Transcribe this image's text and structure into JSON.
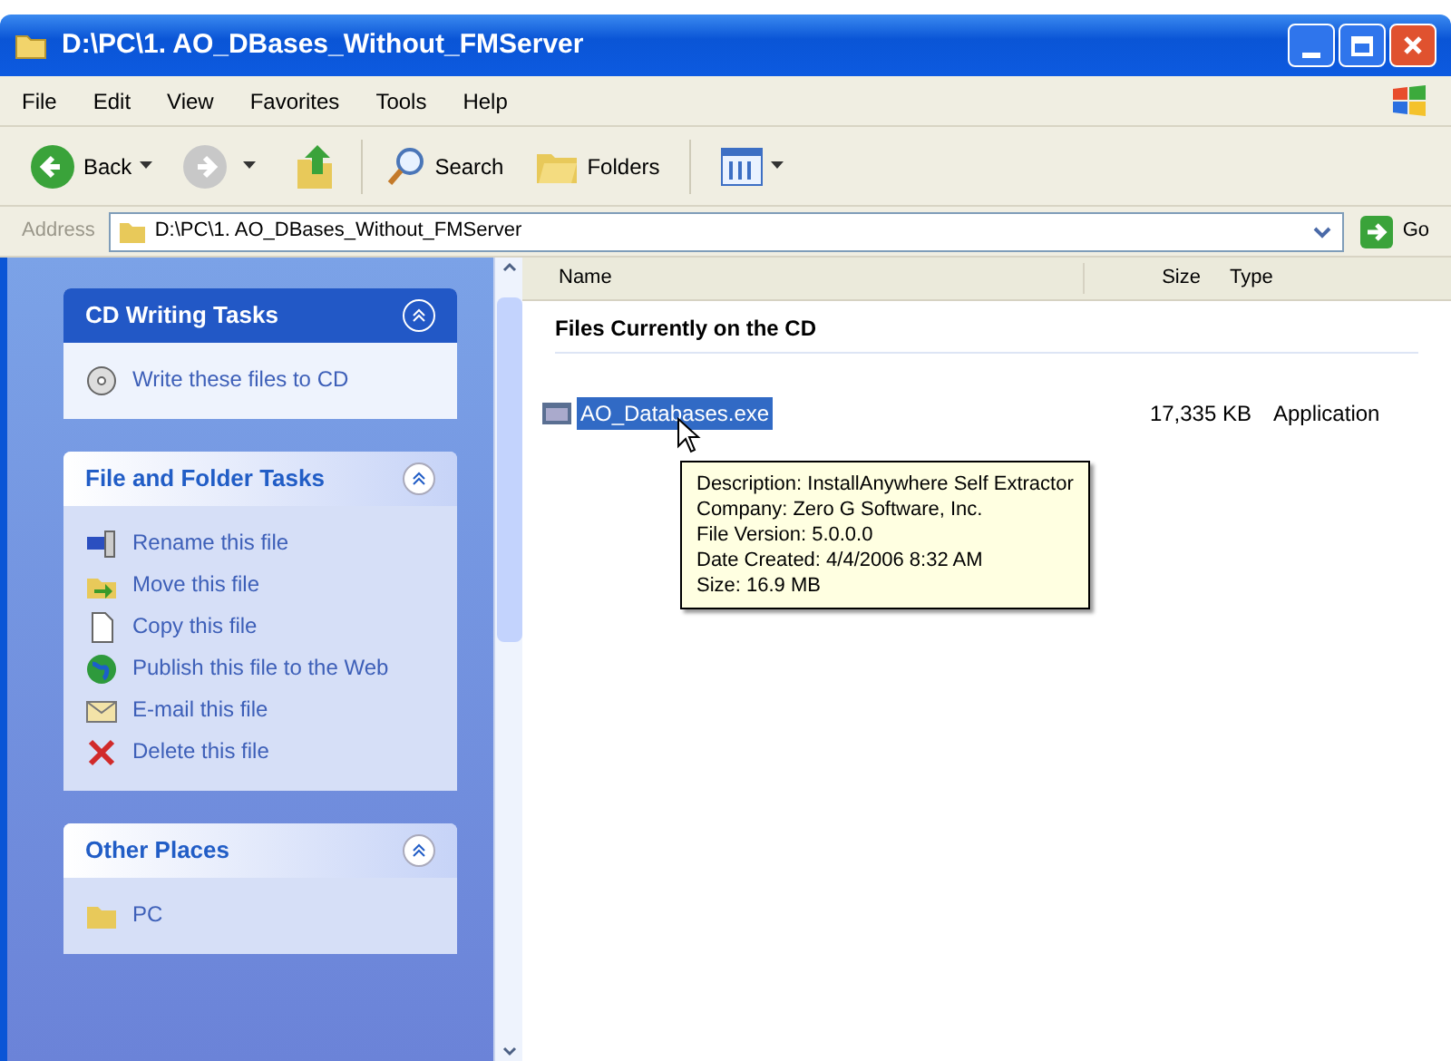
{
  "window": {
    "title": "D:\\PC\\1. AO_DBases_Without_FMServer"
  },
  "menu": [
    "File",
    "Edit",
    "View",
    "Favorites",
    "Tools",
    "Help"
  ],
  "toolbar": {
    "back": "Back",
    "search": "Search",
    "folders": "Folders"
  },
  "address": {
    "label": "Address",
    "value": "D:\\PC\\1. AO_DBases_Without_FMServer",
    "go": "Go"
  },
  "task_panels": [
    {
      "title": "CD Writing Tasks",
      "kind": "special",
      "items": [
        "Write these files to CD"
      ]
    },
    {
      "title": "File and Folder Tasks",
      "kind": "normal",
      "items": [
        "Rename this file",
        "Move this file",
        "Copy this file",
        "Publish this file to the Web",
        "E-mail this file",
        "Delete this file"
      ]
    },
    {
      "title": "Other Places",
      "kind": "normal",
      "items": [
        "PC"
      ]
    }
  ],
  "file_list": {
    "columns": [
      "Name",
      "Size",
      "Type"
    ],
    "group": "Files Currently on the CD",
    "files": [
      {
        "name": "AO_Databases.exe",
        "size": "17,335 KB",
        "type": "Application",
        "selected": true
      }
    ]
  },
  "tooltip": [
    "Description: InstallAnywhere Self Extractor",
    "Company: Zero G Software, Inc.",
    "File Version: 5.0.0.0",
    "Date Created: 4/4/2006 8:32 AM",
    "Size: 16.9 MB"
  ]
}
